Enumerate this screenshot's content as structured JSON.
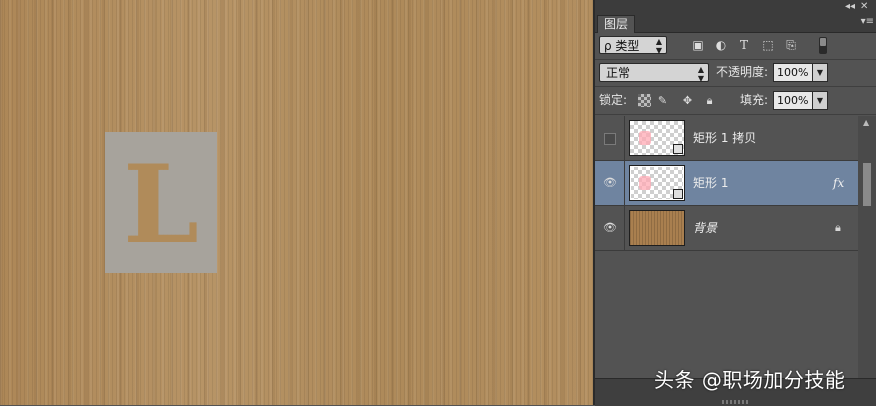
{
  "panel": {
    "tab_label": "图层",
    "collapse_glyph": "◂◂",
    "close_glyph": "✕",
    "menu_glyph": "▾≡"
  },
  "filter": {
    "kind_label": "ρ 类型",
    "icons": [
      "image-filter-icon",
      "adjustment-filter-icon",
      "text-filter-icon",
      "shape-filter-icon",
      "smart-object-filter-icon"
    ]
  },
  "blend": {
    "mode": "正常",
    "opacity_label": "不透明度:",
    "opacity_value": "100%"
  },
  "lock": {
    "label": "锁定:",
    "fill_label": "填充:",
    "fill_value": "100%"
  },
  "layers": [
    {
      "name": "矩形 1 拷贝",
      "visible": false,
      "selected": false,
      "type": "shape"
    },
    {
      "name": "矩形 1",
      "visible": true,
      "selected": true,
      "type": "shape",
      "fx": "fx"
    },
    {
      "name": "背景",
      "visible": true,
      "selected": false,
      "type": "background",
      "locked": true
    }
  ],
  "canvas": {
    "stencil_letter": "L",
    "accent_colors": {
      "cardboard": "#b08b5a",
      "stencil": "#a7a39c",
      "selection": "#6f84a0"
    }
  },
  "watermark": "头条 @职场加分技能"
}
